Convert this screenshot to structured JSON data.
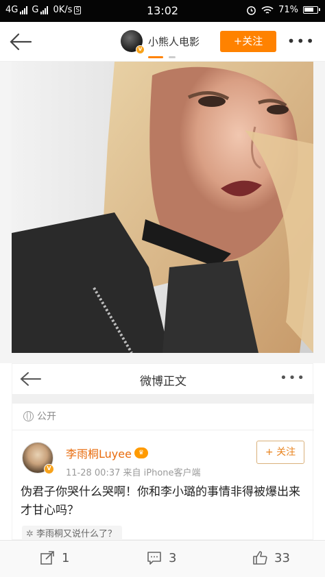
{
  "status_bar": {
    "network_1": "4G",
    "network_2": "G",
    "speed": "0K/s",
    "time": "13:02",
    "battery": "71%"
  },
  "top_nav": {
    "author_name": "小熊人电影",
    "follow_label": "+关注",
    "more_label": "•••"
  },
  "inner_post": {
    "header_title": "微博正文",
    "more_label": "•••",
    "visibility": "公开",
    "user_name": "李雨桐Luyee",
    "meta": "11-28 00:37  来自 iPhone客户端",
    "follow_label": "+ 关注",
    "text": "伪君子你哭什么哭啊！你和李小璐的事情非得被爆出来才甘心吗？",
    "repost_tag": "李雨桐又说什么了？"
  },
  "bottom_bar": {
    "share_count": "1",
    "comment_count": "3",
    "like_count": "33"
  },
  "colors": {
    "accent": "#ff8200",
    "status_bar_bg": "#050505",
    "username_orange": "#e86b0c"
  }
}
